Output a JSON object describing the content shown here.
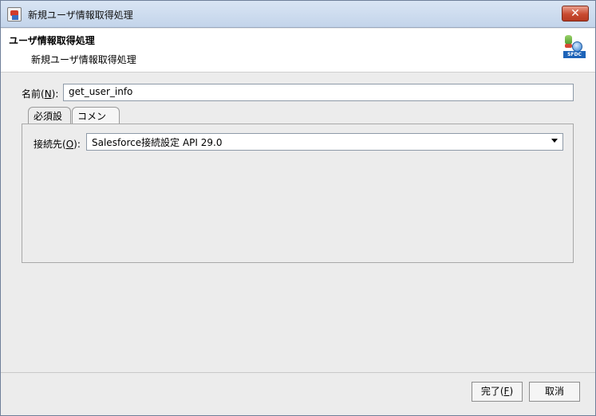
{
  "window": {
    "title": "新規ユーザ情報取得処理",
    "close_label": "✕"
  },
  "header": {
    "title": "ユーザ情報取得処理",
    "subtitle": "新規ユーザ情報取得処理",
    "icon_tag": "SFDC"
  },
  "form": {
    "name_label_prefix": "名前(",
    "name_mnemonic": "N",
    "name_label_suffix": "):",
    "name_value": "get_user_info"
  },
  "tabs": [
    {
      "label": "必須設定",
      "active": true
    },
    {
      "label": "コメント",
      "active": false
    }
  ],
  "connection": {
    "label_prefix": "接続先(",
    "label_mnemonic": "O",
    "label_suffix": "):",
    "value": "Salesforce接続設定 API 29.0"
  },
  "buttons": {
    "finish_prefix": "完了(",
    "finish_mnemonic": "F",
    "finish_suffix": ")",
    "cancel": "取消"
  }
}
